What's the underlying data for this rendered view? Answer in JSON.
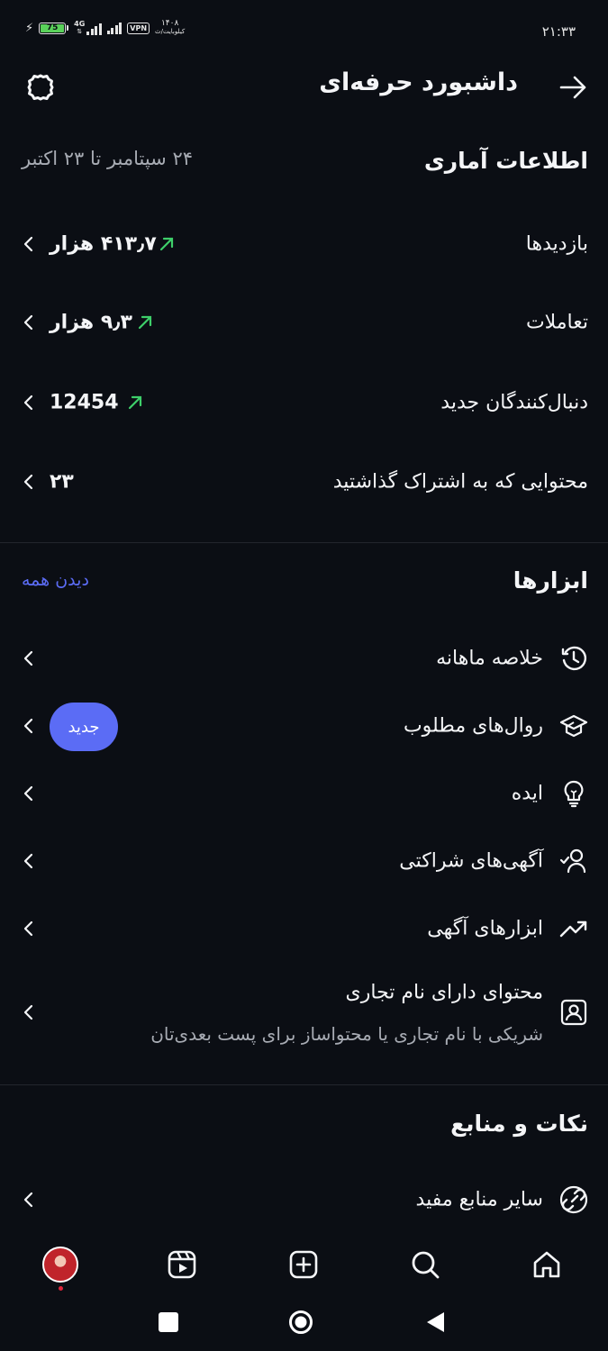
{
  "status_bar": {
    "battery": "75",
    "network": "4G",
    "vpn": "VPN",
    "carrier_top": "۱۴۰۸",
    "carrier_bottom": "کیلوبایت/ث",
    "time": "۲۱:۳۳"
  },
  "header": {
    "title": "داشبورد حرفه‌ای",
    "back_icon": "arrow-right-icon",
    "settings_icon": "gear-icon"
  },
  "stats": {
    "title": "اطلاعات آماری",
    "date_range": "۲۴ سپتامبر تا ۲۳ اکتبر",
    "rows": [
      {
        "label": "بازدیدها",
        "value": "۴۱۳٫۷ هزار",
        "trend": "up"
      },
      {
        "label": "تعاملات",
        "value": "۹٫۳ هزار",
        "trend": "up"
      },
      {
        "label": "دنبال‌کنندگان جدید",
        "value": "12454",
        "trend": "up"
      },
      {
        "label": "محتوایی که به اشتراک گذاشتید",
        "value": "۲۳",
        "trend": ""
      }
    ]
  },
  "tools": {
    "title": "ابزارها",
    "see_all": "دیدن همه",
    "items": [
      {
        "label": "خلاصه ماهانه",
        "icon": "history-clock-icon"
      },
      {
        "label": "روال‌های مطلوب",
        "icon": "graduation-cap-icon",
        "badge": "جدید"
      },
      {
        "label": "ایده",
        "icon": "lightbulb-icon"
      },
      {
        "label": "آگهی‌های شراکتی",
        "icon": "user-check-icon"
      },
      {
        "label": "ابزارهای آگهی",
        "icon": "trending-up-icon"
      },
      {
        "label": "محتوای دارای نام تجاری",
        "sublabel": "شریکی با نام تجاری یا محتواساز برای پست بعدی‌تان",
        "icon": "user-badge-icon"
      }
    ]
  },
  "resources": {
    "title": "نکات و منابع",
    "items": [
      {
        "label": "سایر منابع مفید",
        "icon": "link-icon"
      }
    ]
  },
  "bottom_nav": [
    "home-icon",
    "search-icon",
    "create-icon",
    "reels-icon",
    "profile-avatar"
  ],
  "colors": {
    "background": "#0b0e14",
    "accent": "#5b6cf5",
    "trend_up": "#3ecf6a",
    "muted_text": "#a7abb3"
  }
}
